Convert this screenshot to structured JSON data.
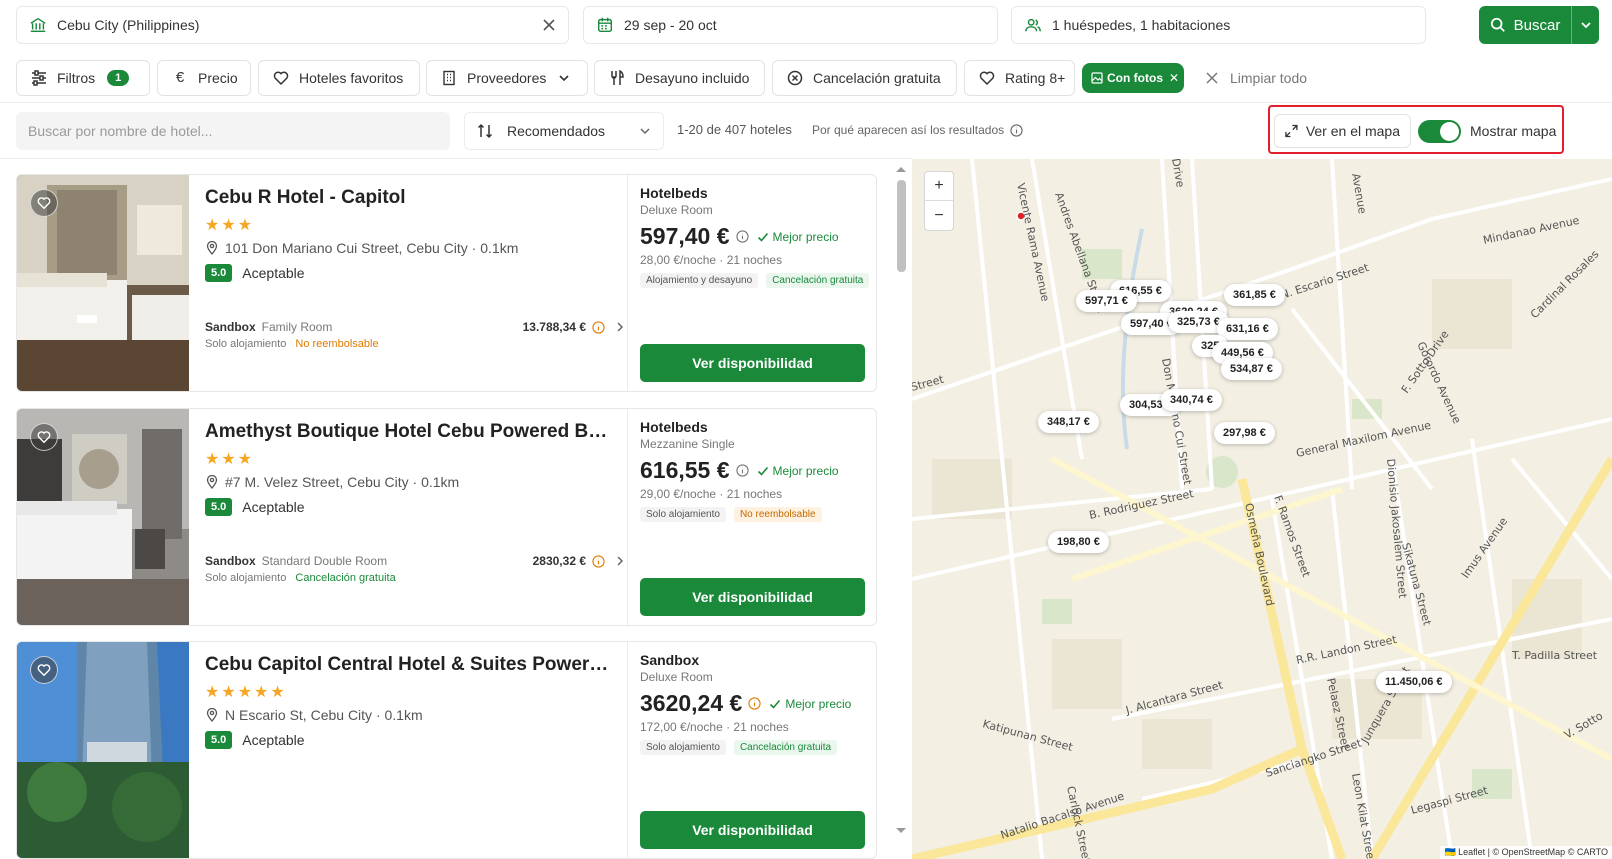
{
  "search": {
    "destination": "Cebu City (Philippines)",
    "dates": "29 sep - 20 oct",
    "guests": "1 huéspedes, 1 habitaciones",
    "button": "Buscar"
  },
  "filters": {
    "filtros": "Filtros",
    "filtros_count": "1",
    "precio": "Precio",
    "favoritos": "Hoteles favoritos",
    "proveedores": "Proveedores",
    "desayuno": "Desayuno incluido",
    "cancelacion": "Cancelación gratuita",
    "rating": "Rating 8+",
    "con_fotos": "Con fotos",
    "limpiar": "Limpiar todo"
  },
  "toolbar": {
    "hotel_search_placeholder": "Buscar por nombre de hotel...",
    "sort": "Recomendados",
    "count": "1-20 de 407 hoteles",
    "why": "Por qué aparecen así los resultados",
    "map_button": "Ver en el mapa",
    "toggle_label": "Mostrar mapa"
  },
  "hotels": [
    {
      "name": "Cebu R Hotel - Capitol",
      "stars": "★★★",
      "address": "101 Don Mariano Cui Street, Cebu City · 0.1km",
      "score": "5.0",
      "rating_label": "Aceptable",
      "offer_provider": "Hotelbeds",
      "offer_room": "Deluxe Room",
      "price": "597,40 €",
      "best_label": "Mejor precio",
      "per_night": "28,00 €/noche · 21 noches",
      "tag1": "Alojamiento y desayuno",
      "tag2": "Cancelación gratuita",
      "alt_provider": "Sandbox",
      "alt_room": "Family Room",
      "alt_price": "13.788,34 €",
      "alt_board": "Solo alojamiento",
      "alt_policy": "No reembolsable",
      "button": "Ver disponibilidad"
    },
    {
      "name": "Amethyst Boutique Hotel Cebu Powered By Coc...",
      "stars": "★★★",
      "address": "#7 M. Velez Street, Cebu City · 0.1km",
      "score": "5.0",
      "rating_label": "Aceptable",
      "offer_provider": "Hotelbeds",
      "offer_room": "Mezzanine Single",
      "price": "616,55 €",
      "best_label": "Mejor precio",
      "per_night": "29,00 €/noche · 21 noches",
      "tag1": "Solo alojamiento",
      "tag2": "No reembolsable",
      "alt_provider": "Sandbox",
      "alt_room": "Standard Double Room",
      "alt_price": "2830,32 €",
      "alt_board": "Solo alojamiento",
      "alt_policy": "Cancelación gratuita",
      "button": "Ver disponibilidad"
    },
    {
      "name": "Cebu Capitol Central Hotel & Suites Powered By...",
      "stars": "★★★★★",
      "address": "N Escario St, Cebu City · 0.1km",
      "score": "5.0",
      "rating_label": "Aceptable",
      "offer_provider": "Sandbox",
      "offer_room": "Deluxe Room",
      "price": "3620,24 €",
      "best_label": "Mejor precio",
      "per_night": "172,00 €/noche · 21 noches",
      "tag1": "Solo alojamiento",
      "tag2": "Cancelación gratuita",
      "button": "Ver disponibilidad"
    }
  ],
  "map": {
    "streets": {
      "s1": "Vicente Rama Avenue",
      "s2": "Andres Abellana Street",
      "s3": "N. Escario Street",
      "s4": "Mindanao Avenue",
      "s5": "Cardinal Rosales",
      "s6": "General Maxilom Avenue",
      "s7": "B. Rodriguez Street",
      "s8": "Osmeña Boulevard",
      "s9": "Gorordo Avenue",
      "s10": "Imus Avenue",
      "s11": "Katipunan Street",
      "s12": "Natalio Bacalso Avenue",
      "s13": "R.R. Landon Street",
      "s14": "J. Alcantara Street",
      "s15": "Don Mariano Cui Street",
      "s16": "F. Ramos Street",
      "s17": "Sikatuna Street",
      "s18": "T. Padilla Street",
      "s19": "Junquera Street",
      "s20": "Sanciangko Street",
      "s21": "Pelaez Street",
      "s22": "Leon Kilat Street",
      "s23": "Legaspi Street",
      "s24": "Carlock Street",
      "s25": "Dionisio Jakosalem Street",
      "s26": "F. Sotto Drive",
      "s27": "Street",
      "s28": "Drive",
      "s29": "Avenue",
      "s30": "V. Sotto"
    },
    "pins": [
      {
        "label": "616,55 €"
      },
      {
        "label": "597,71 €"
      },
      {
        "label": "3620,24 €"
      },
      {
        "label": "361,85 €"
      },
      {
        "label": "597,40 €"
      },
      {
        "label": "325,73 €"
      },
      {
        "label": "631,16 €"
      },
      {
        "label": "325"
      },
      {
        "label": "449,56 €"
      },
      {
        "label": "534,87 €"
      },
      {
        "label": "304,53 €"
      },
      {
        "label": "340,74 €"
      },
      {
        "label": "348,17 €"
      },
      {
        "label": "297,98 €"
      },
      {
        "label": "198,80 €"
      },
      {
        "label": "11.450,06 €"
      }
    ],
    "zoom_in": "+",
    "zoom_out": "−",
    "attribution": "🇺🇦 Leaflet | © OpenStreetMap © CARTO"
  }
}
